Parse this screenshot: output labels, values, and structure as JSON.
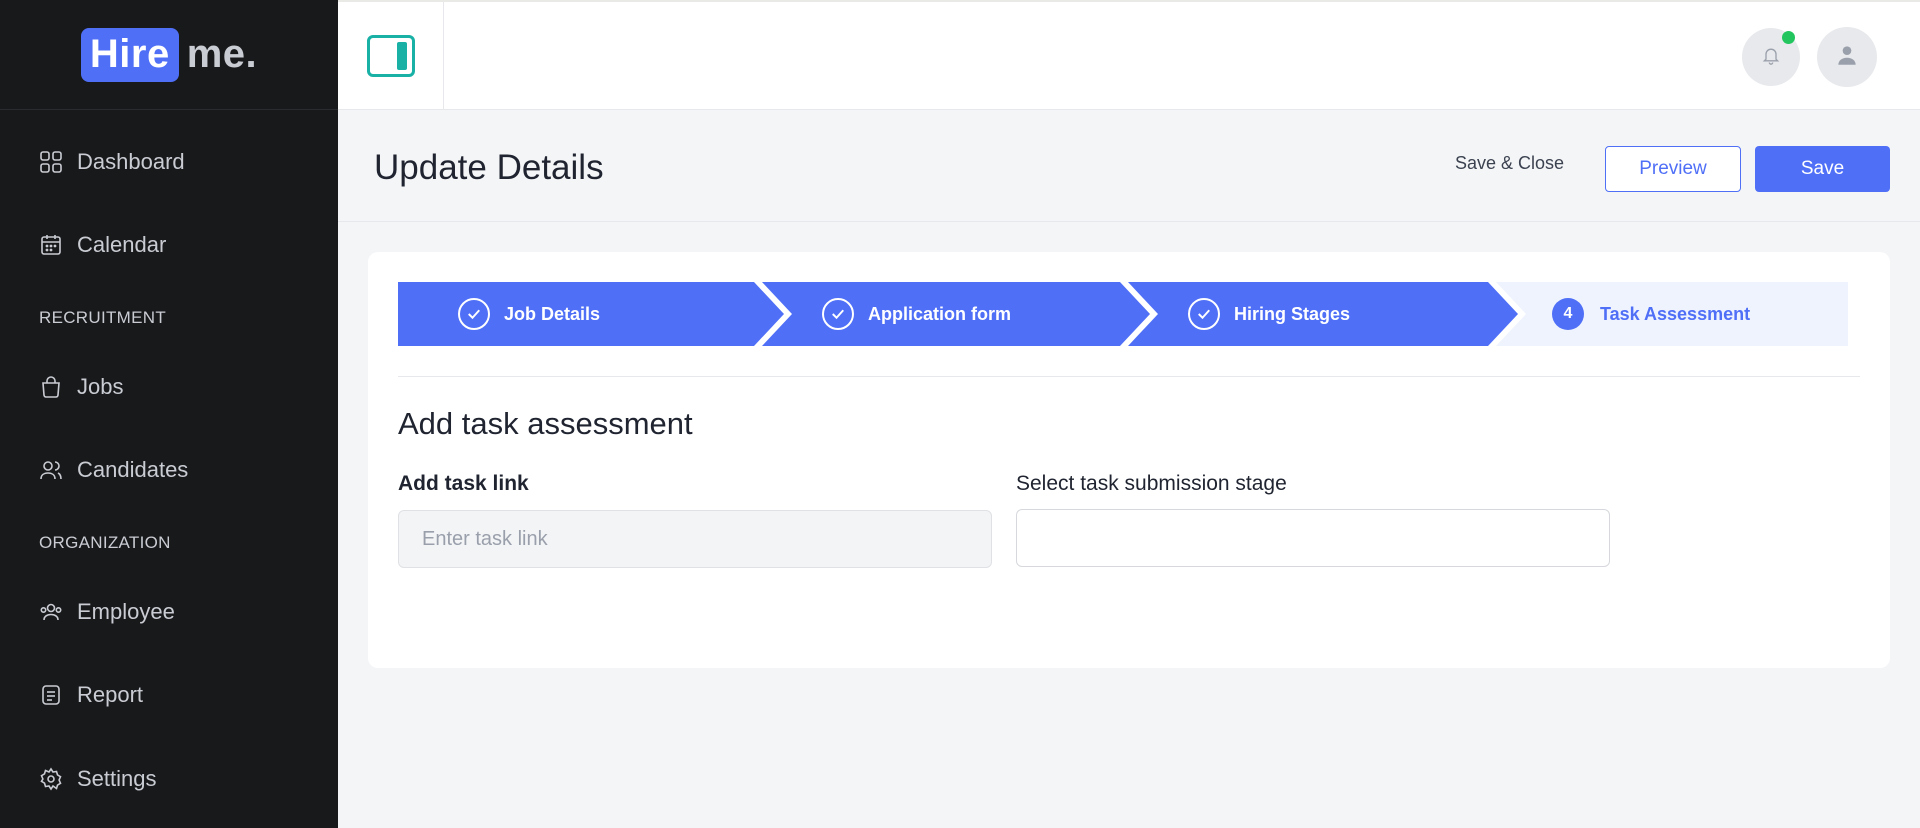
{
  "brand": {
    "logo_part1": "Hire",
    "logo_part2": "me.",
    "accent": "#4f6ff7",
    "toggle_color": "#19b1a6"
  },
  "sidebar": {
    "items": [
      {
        "label": "Dashboard",
        "icon": "grid-icon"
      },
      {
        "label": "Calendar",
        "icon": "calendar-icon"
      },
      {
        "section": "RECRUITMENT"
      },
      {
        "label": "Jobs",
        "icon": "bag-icon"
      },
      {
        "label": "Candidates",
        "icon": "users-icon"
      },
      {
        "section": "ORGANIZATION"
      },
      {
        "label": "Employee",
        "icon": "group-icon"
      },
      {
        "label": "Report",
        "icon": "document-icon"
      },
      {
        "label": "Settings",
        "icon": "gear-icon"
      }
    ]
  },
  "topbar": {
    "notification_dot_color": "#22c55e"
  },
  "header": {
    "title": "Update Details",
    "save_close": "Save & Close",
    "preview": "Preview",
    "save": "Save"
  },
  "stepper": {
    "steps": [
      {
        "label": "Job Details",
        "state": "completed"
      },
      {
        "label": "Application form",
        "state": "completed"
      },
      {
        "label": "Hiring Stages",
        "state": "completed"
      },
      {
        "label": "Task Assessment",
        "state": "active",
        "number": "4"
      }
    ]
  },
  "form": {
    "section_title": "Add task assessment",
    "task_link_label": "Add task link",
    "task_link_placeholder": "Enter task link",
    "task_link_value": "",
    "stage_label": "Select task submission stage",
    "stage_value": ""
  }
}
